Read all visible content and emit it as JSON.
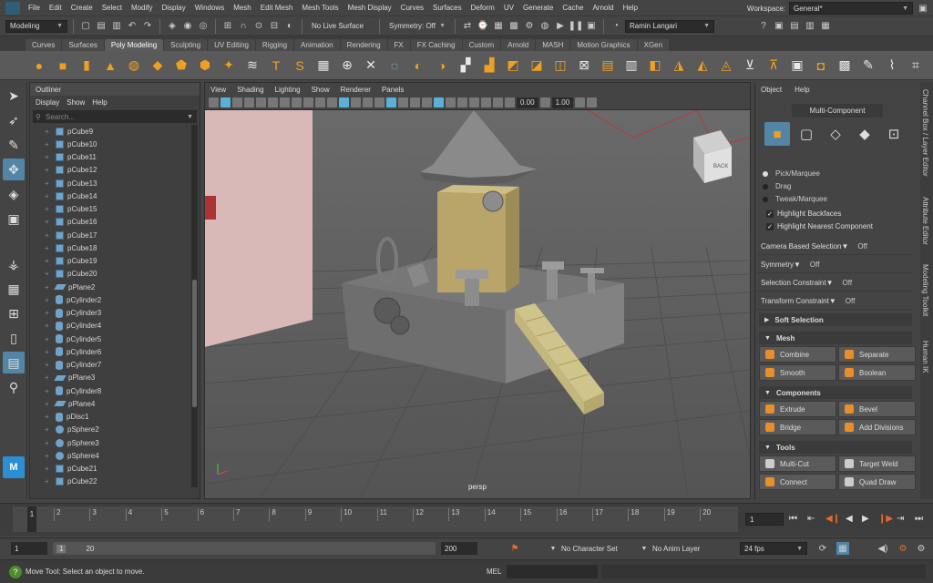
{
  "menubar": {
    "items": [
      "File",
      "Edit",
      "Create",
      "Select",
      "Modify",
      "Display",
      "Windows",
      "Mesh",
      "Edit Mesh",
      "Mesh Tools",
      "Mesh Display",
      "Curves",
      "Surfaces",
      "Deform",
      "UV",
      "Generate",
      "Cache",
      "Arnold",
      "Help"
    ],
    "workspace_label": "Workspace:",
    "workspace_value": "General*"
  },
  "statusline": {
    "menuset": "Modeling",
    "live_surface": "No Live Surface",
    "symmetry": "Symmetry: Off",
    "user": "Ramin Langari"
  },
  "shelf": {
    "tabs": [
      "Curves",
      "Surfaces",
      "Poly Modeling",
      "Sculpting",
      "UV Editing",
      "Rigging",
      "Animation",
      "Rendering",
      "FX",
      "FX Caching",
      "Custom",
      "Arnold",
      "MASH",
      "Motion Graphics",
      "XGen"
    ],
    "active_tab": "Poly Modeling"
  },
  "outliner": {
    "title": "Outliner",
    "menu": [
      "Display",
      "Show",
      "Help"
    ],
    "search_placeholder": "Search...",
    "items": [
      {
        "name": "pCube9",
        "kind": "cube"
      },
      {
        "name": "pCube10",
        "kind": "cube"
      },
      {
        "name": "pCube11",
        "kind": "cube"
      },
      {
        "name": "pCube12",
        "kind": "cube"
      },
      {
        "name": "pCube13",
        "kind": "cube"
      },
      {
        "name": "pCube14",
        "kind": "cube"
      },
      {
        "name": "pCube15",
        "kind": "cube"
      },
      {
        "name": "pCube16",
        "kind": "cube"
      },
      {
        "name": "pCube17",
        "kind": "cube"
      },
      {
        "name": "pCube18",
        "kind": "cube"
      },
      {
        "name": "pCube19",
        "kind": "cube"
      },
      {
        "name": "pCube20",
        "kind": "cube"
      },
      {
        "name": "pPlane2",
        "kind": "plane"
      },
      {
        "name": "pCylinder2",
        "kind": "cylinder"
      },
      {
        "name": "pCylinder3",
        "kind": "cylinder"
      },
      {
        "name": "pCylinder4",
        "kind": "cylinder"
      },
      {
        "name": "pCylinder5",
        "kind": "cylinder"
      },
      {
        "name": "pCylinder6",
        "kind": "cylinder"
      },
      {
        "name": "pCylinder7",
        "kind": "cylinder"
      },
      {
        "name": "pPlane3",
        "kind": "plane"
      },
      {
        "name": "pCylinder8",
        "kind": "cylinder"
      },
      {
        "name": "pPlane4",
        "kind": "plane"
      },
      {
        "name": "pDisc1",
        "kind": "cylinder"
      },
      {
        "name": "pSphere2",
        "kind": "sphere"
      },
      {
        "name": "pSphere3",
        "kind": "sphere"
      },
      {
        "name": "pSphere4",
        "kind": "sphere"
      },
      {
        "name": "pCube21",
        "kind": "cube"
      },
      {
        "name": "pCube22",
        "kind": "cube"
      }
    ]
  },
  "viewport": {
    "menu": [
      "View",
      "Shading",
      "Lighting",
      "Show",
      "Renderer",
      "Panels"
    ],
    "near_value": "0.00",
    "far_value": "1.00",
    "camera_label": "persp",
    "viewcube_label": "BACK"
  },
  "modeling_toolkit": {
    "menu": [
      "Object",
      "Help"
    ],
    "mode": "Multi-Component",
    "radios": [
      "Pick/Marquee",
      "Drag",
      "Tweak/Marquee"
    ],
    "checks": [
      "Highlight Backfaces",
      "Highlight Nearest Component"
    ],
    "props": [
      {
        "label": "Camera Based Selection",
        "value": "Off"
      },
      {
        "label": "Symmetry",
        "value": "Off"
      },
      {
        "label": "Selection Constraint",
        "value": "Off"
      },
      {
        "label": "Transform Constraint",
        "value": "Off"
      }
    ],
    "soft_selection": "Soft Selection",
    "sections": {
      "mesh": "Mesh",
      "components": "Components",
      "tools": "Tools"
    },
    "buttons": {
      "combine": "Combine",
      "separate": "Separate",
      "smooth": "Smooth",
      "boolean": "Boolean",
      "extrude": "Extrude",
      "bevel": "Bevel",
      "bridge": "Bridge",
      "add_divisions": "Add Divisions",
      "multi_cut": "Multi-Cut",
      "target_weld": "Target Weld",
      "connect": "Connect",
      "quad_draw": "Quad Draw"
    }
  },
  "side_tabs": [
    "Channel Box / Layer Editor",
    "Attribute Editor",
    "Modeling Toolkit",
    "Human IK"
  ],
  "timeline": {
    "ticks": [
      "2",
      "3",
      "4",
      "5",
      "6",
      "7",
      "8",
      "9",
      "10",
      "11",
      "12",
      "13",
      "14",
      "15",
      "16",
      "17",
      "18",
      "19",
      "20"
    ],
    "current_frame": "1",
    "current_frame_field": "1"
  },
  "range": {
    "start": "1",
    "inner_start": "1",
    "inner_end": "20",
    "end": "200",
    "character_set": "No Character Set",
    "anim_layer": "No Anim Layer",
    "fps": "24 fps"
  },
  "helpline": {
    "message": "Move Tool: Select an object to move.",
    "mel_label": "MEL"
  }
}
